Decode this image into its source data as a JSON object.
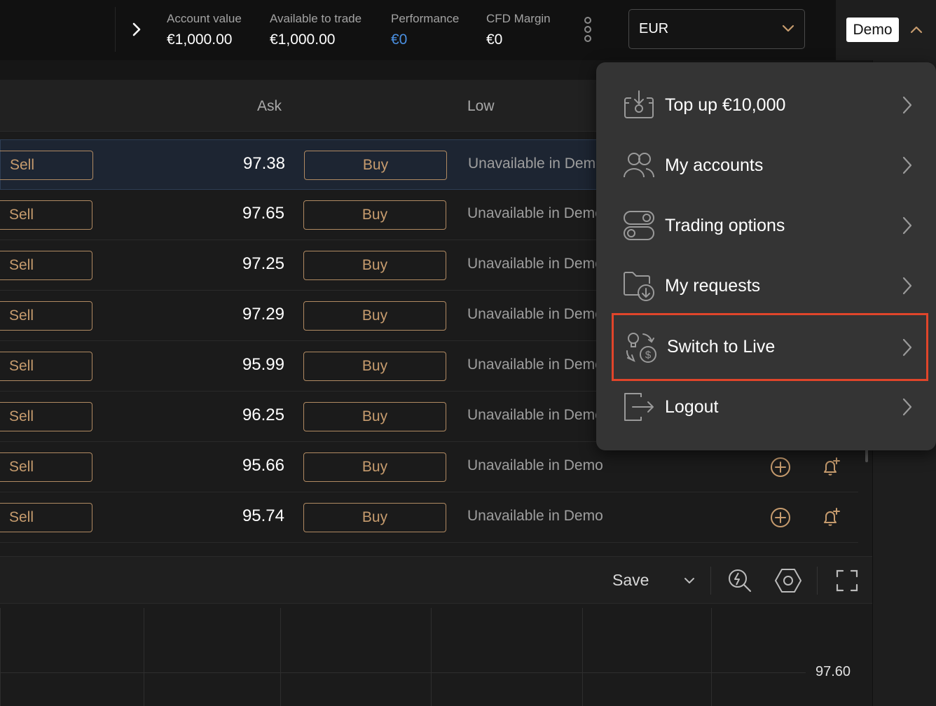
{
  "header": {
    "stats": [
      {
        "label": "Account value",
        "value": "€1,000.00"
      },
      {
        "label": "Available to trade",
        "value": "€1,000.00"
      },
      {
        "label": "Performance",
        "value": "€0"
      },
      {
        "label": "CFD Margin",
        "value": "€0"
      }
    ],
    "currency": "EUR",
    "account_mode": "Demo"
  },
  "table": {
    "columns": {
      "ask": "Ask",
      "low": "Low"
    },
    "rows": [
      {
        "sell": "Sell",
        "ask": "97.38",
        "buy": "Buy",
        "low": "Unavailable in Demo"
      },
      {
        "sell": "Sell",
        "ask": "97.65",
        "buy": "Buy",
        "low": "Unavailable in Demo"
      },
      {
        "sell": "Sell",
        "ask": "97.25",
        "buy": "Buy",
        "low": "Unavailable in Demo"
      },
      {
        "sell": "Sell",
        "ask": "97.29",
        "buy": "Buy",
        "low": "Unavailable in Demo"
      },
      {
        "sell": "Sell",
        "ask": "95.99",
        "buy": "Buy",
        "low": "Unavailable in Demo"
      },
      {
        "sell": "Sell",
        "ask": "96.25",
        "buy": "Buy",
        "low": "Unavailable in Demo"
      },
      {
        "sell": "Sell",
        "ask": "95.66",
        "buy": "Buy",
        "low": "Unavailable in Demo"
      },
      {
        "sell": "Sell",
        "ask": "95.74",
        "buy": "Buy",
        "low": "Unavailable in Demo"
      }
    ]
  },
  "toolbar": {
    "save_label": "Save",
    "icons": [
      "chevron-down-icon",
      "flash-search-icon",
      "settings-hex-icon",
      "fullscreen-icon"
    ]
  },
  "chart": {
    "price_label": "97.60"
  },
  "menu": {
    "items": [
      {
        "label": "Top up €10,000",
        "icon": "top-up-icon"
      },
      {
        "label": "My accounts",
        "icon": "users-icon"
      },
      {
        "label": "Trading options",
        "icon": "toggles-icon"
      },
      {
        "label": "My requests",
        "icon": "folder-download-icon"
      },
      {
        "label": "Switch to Live",
        "icon": "switch-live-icon"
      },
      {
        "label": "Logout",
        "icon": "logout-icon"
      }
    ],
    "highlighted": "Switch to Live"
  },
  "colors": {
    "accent_outline": "#b08a62",
    "performance_blue": "#4a8fe0",
    "highlight_border": "#e0452a",
    "menu_bg": "#343434"
  }
}
